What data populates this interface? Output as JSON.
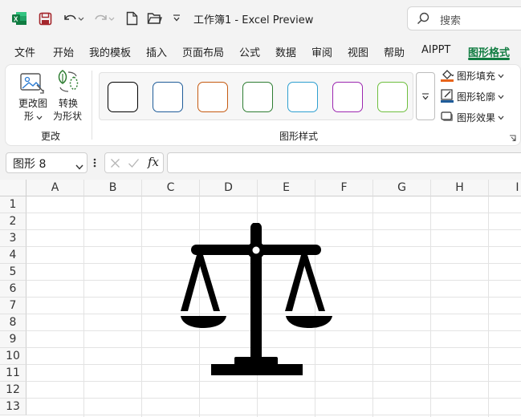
{
  "titlebar": {
    "title": "工作簿1  -  Excel Preview",
    "search_placeholder": "搜索"
  },
  "menu": [
    "文件",
    "开始",
    "我的模板",
    "插入",
    "页面布局",
    "公式",
    "数据",
    "审阅",
    "视图",
    "帮助",
    "AIPPT",
    "图形格式"
  ],
  "active_tab": "图形格式",
  "ribbon": {
    "change_shape_line1": "更改图",
    "change_shape_line2": "形",
    "convert_line1": "转换",
    "convert_line2": "为形状",
    "group_change": "更改",
    "group_styles": "图形样式",
    "fill": "图形填充",
    "outline": "图形轮廓",
    "effects": "图形效果",
    "swatch_colors": [
      "#000000",
      "#1f5c99",
      "#c55a11",
      "#2e7d32",
      "#2e9fd0",
      "#9c27b0",
      "#6fbf3f"
    ]
  },
  "formula_bar": {
    "name_box": "图形 8",
    "fx": "fx",
    "formula": ""
  },
  "sheet": {
    "columns": [
      "A",
      "B",
      "C",
      "D",
      "E",
      "F",
      "G",
      "H",
      "I"
    ],
    "rows": [
      "1",
      "2",
      "3",
      "4",
      "5",
      "6",
      "7",
      "8",
      "9",
      "10",
      "11",
      "12",
      "13"
    ]
  }
}
